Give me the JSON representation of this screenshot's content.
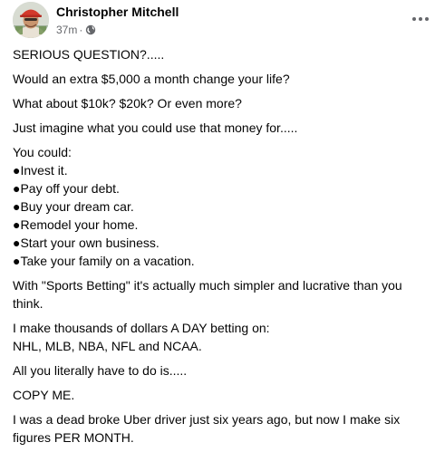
{
  "post": {
    "author": "Christopher Mitchell",
    "time": "37m",
    "separator": "·",
    "audience_icon": "globe-icon",
    "more_icon": "more-options-icon",
    "paragraphs": [
      [
        "SERIOUS QUESTION?....."
      ],
      [
        "Would an extra $5,000 a month change your life?"
      ],
      [
        "What about $10k? $20k? Or even more?"
      ],
      [
        "Just imagine what you could use that money for....."
      ],
      [
        "You could:",
        "●Invest it.",
        "●Pay off your debt.",
        "●Buy your dream car.",
        "●Remodel your home.",
        "●Start your own business.",
        "●Take your family on a vacation."
      ],
      [
        "With \"Sports Betting\" it's actually much simpler and lucrative than you",
        "think."
      ],
      [
        "I make thousands of dollars A DAY betting on:",
        "NHL, MLB, NBA, NFL and NCAA."
      ],
      [
        "All you literally have to do is....."
      ],
      [
        "COPY ME."
      ],
      [
        "I was a dead broke Uber driver just six years ago, but now I make six",
        "figures PER MONTH."
      ]
    ]
  },
  "colors": {
    "text": "#050505",
    "secondary": "#65676b"
  }
}
